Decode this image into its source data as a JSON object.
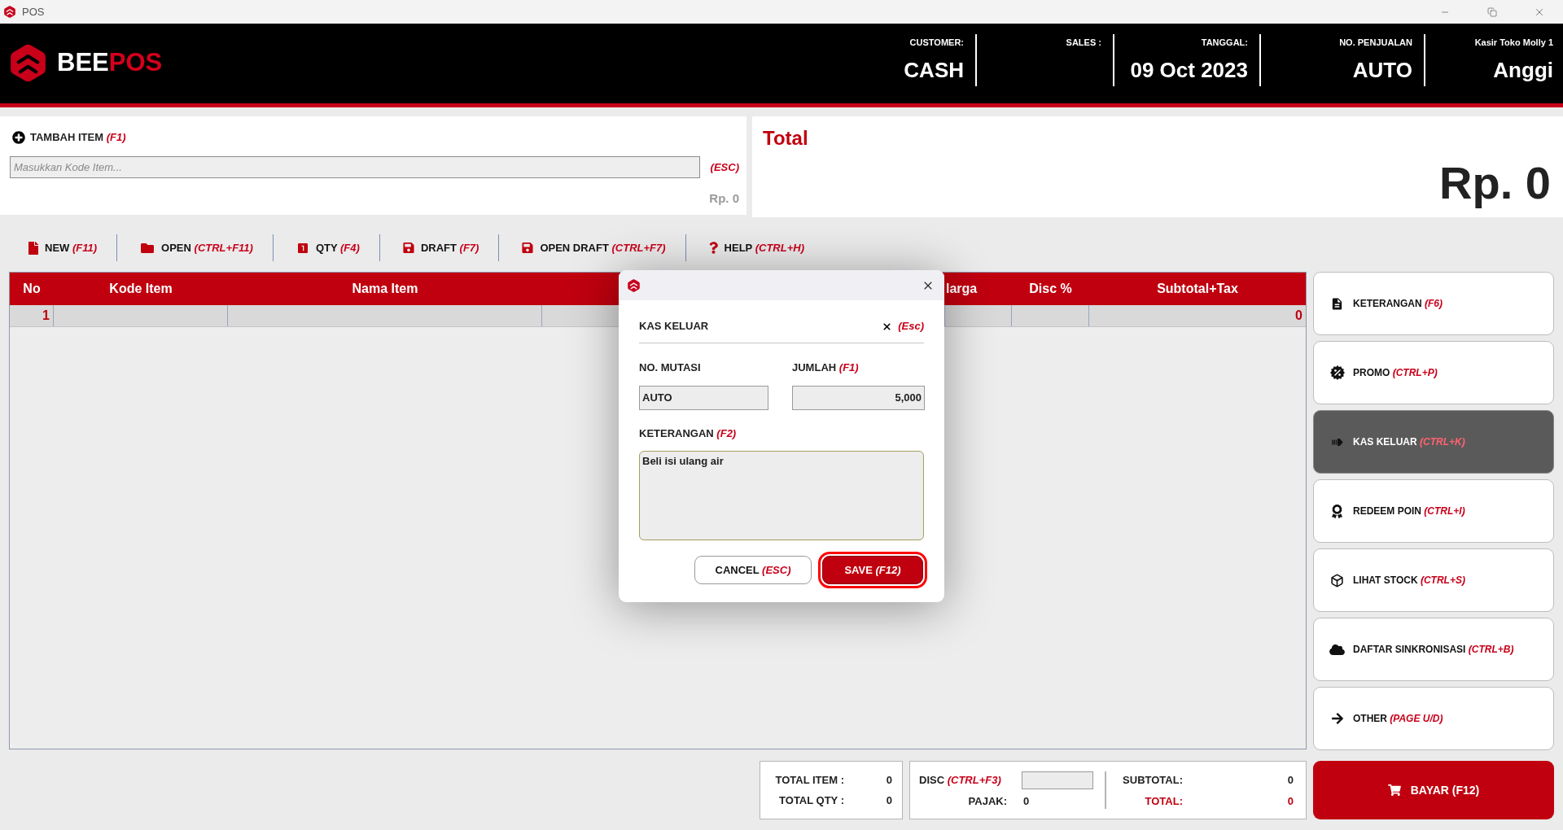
{
  "window": {
    "title": "POS"
  },
  "header": {
    "logo": {
      "primary": "BEE",
      "accent": "POS"
    },
    "fields": [
      {
        "label": "CUSTOMER:",
        "value": "CASH"
      },
      {
        "label": "SALES :"
      },
      {
        "label": "TANGGAL:",
        "value": "09 Oct 2023"
      },
      {
        "label": "NO. PENJUALAN",
        "value": "AUTO"
      },
      {
        "label": "Kasir Toko Molly 1",
        "value": "Anggi"
      }
    ]
  },
  "item_entry": {
    "label": "TAMBAH ITEM",
    "shortcut": "(F1)",
    "placeholder": "Masukkan Kode Item...",
    "clear_shortcut": "(ESC)",
    "price": "Rp. 0"
  },
  "total_panel": {
    "title": "Total",
    "amount": "Rp. 0"
  },
  "toolbar": [
    {
      "label": "NEW",
      "shortcut": "(F11)"
    },
    {
      "label": "OPEN",
      "shortcut": "(CTRL+F11)"
    },
    {
      "label": "QTY",
      "shortcut": "(F4)"
    },
    {
      "label": "DRAFT",
      "shortcut": "(F7)"
    },
    {
      "label": "OPEN DRAFT",
      "shortcut": "(CTRL+F7)"
    },
    {
      "label": "HELP",
      "shortcut": "(CTRL+H)"
    }
  ],
  "table": {
    "columns": [
      "No",
      "Kode Item",
      "Nama Item",
      "larga",
      "Disc %",
      "Subtotal+Tax"
    ],
    "rows": [
      {
        "no": "1",
        "subtotal_tax": "0"
      }
    ]
  },
  "dialog": {
    "title": "KAS KELUAR",
    "close_shortcut": "(Esc)",
    "fields": [
      {
        "label": "NO. MUTASI",
        "value": "AUTO",
        "kind": "text"
      },
      {
        "label": "JUMLAH",
        "shortcut": "(F1)",
        "value": "5,000",
        "kind": "number"
      }
    ],
    "notes": {
      "label": "KETERANGAN",
      "shortcut": "(F2)",
      "value": "Beli isi ulang air"
    },
    "buttons": [
      {
        "label": "CANCEL",
        "shortcut": "(ESC)",
        "kind": "secondary",
        "focused": false
      },
      {
        "label": "SAVE",
        "shortcut": "(F12)",
        "kind": "primary",
        "focused": true
      }
    ]
  },
  "sidebar": {
    "items": [
      {
        "label": "KETERANGAN",
        "shortcut": "(F6)",
        "selected": false
      },
      {
        "label": "PROMO",
        "shortcut": "(CTRL+P)",
        "selected": false
      },
      {
        "label": "KAS KELUAR",
        "shortcut": "(CTRL+K)",
        "selected": true
      },
      {
        "label": "REDEEM POIN",
        "shortcut": "(CTRL+I)",
        "selected": false
      },
      {
        "label": "LIHAT STOCK",
        "shortcut": "(CTRL+S)",
        "selected": false
      },
      {
        "label": "DAFTAR SINKRONISASI",
        "shortcut": "(CTRL+B)",
        "selected": false
      },
      {
        "label": "OTHER",
        "shortcut": "(PAGE U/D)",
        "selected": false
      }
    ]
  },
  "summary": {
    "counts": [
      {
        "label": "TOTAL ITEM :",
        "value": "0"
      },
      {
        "label": "TOTAL QTY :",
        "value": "0"
      }
    ],
    "discount": {
      "label": "DISC",
      "shortcut": "(CTRL+F3)"
    },
    "tax": {
      "label": "PAJAK:",
      "value": "0"
    },
    "totals": [
      {
        "label": "SUBTOTAL:",
        "value": "0",
        "kind": "subtotal"
      },
      {
        "label": "TOTAL:",
        "value": "0",
        "kind": "total"
      }
    ]
  },
  "pay_button": {
    "label": "BAYAR (F12)"
  }
}
